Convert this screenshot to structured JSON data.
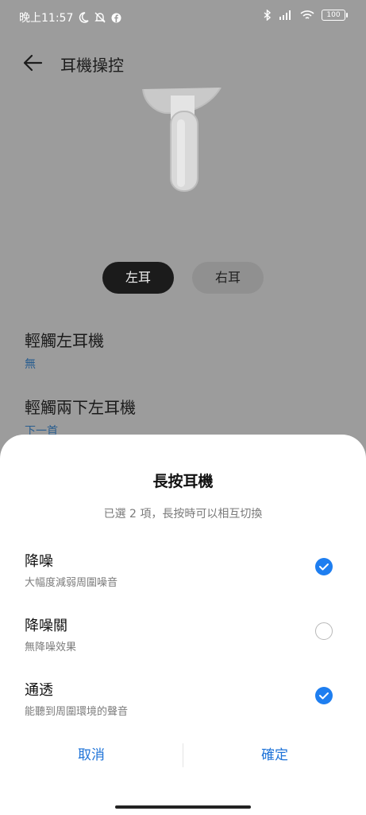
{
  "status_bar": {
    "time": "晚上11:57",
    "battery": "100"
  },
  "header": {
    "title": "耳機操控"
  },
  "ear_toggle": {
    "left_label": "左耳",
    "right_label": "右耳",
    "selected": "左耳"
  },
  "settings": [
    {
      "name": "輕觸左耳機",
      "value": "無"
    },
    {
      "name": "輕觸兩下左耳機",
      "value": "下一首"
    }
  ],
  "sheet": {
    "title": "長按耳機",
    "subtitle": "已選 2 項，長按時可以相互切換",
    "options": [
      {
        "title": "降噪",
        "desc": "大幅度減弱周圍噪音",
        "checked": true
      },
      {
        "title": "降噪關",
        "desc": "無降噪效果",
        "checked": false
      },
      {
        "title": "通透",
        "desc": "能聽到周圍環境的聲音",
        "checked": true
      }
    ],
    "cancel_label": "取消",
    "ok_label": "確定"
  },
  "colors": {
    "accent": "#1e7ef0",
    "link": "#1e73d8",
    "scrim": "#9c9c9c"
  }
}
